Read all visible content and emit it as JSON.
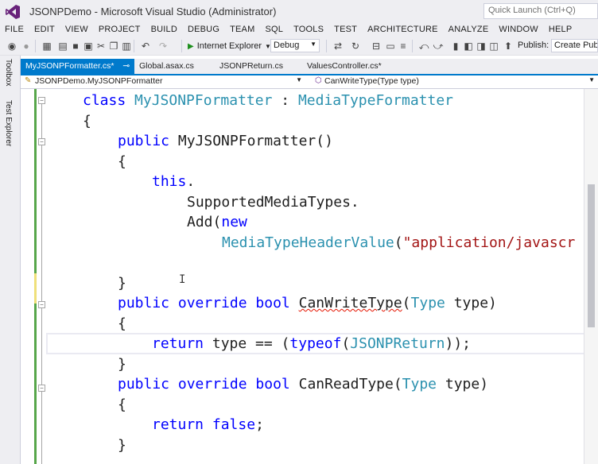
{
  "window": {
    "title": "JSONPDemo - Microsoft Visual Studio (Administrator)",
    "quick_launch_placeholder": "Quick Launch (Ctrl+Q)"
  },
  "menu": [
    "FILE",
    "EDIT",
    "VIEW",
    "PROJECT",
    "BUILD",
    "DEBUG",
    "TEAM",
    "SQL",
    "TOOLS",
    "TEST",
    "ARCHITECTURE",
    "ANALYZE",
    "WINDOW",
    "HELP"
  ],
  "toolbar": {
    "run_target": "Internet Explorer",
    "configuration": "Debug",
    "publish_label": "Publish:",
    "publish_value": "Create Publ"
  },
  "sidebar": {
    "toolbox": "Toolbox",
    "test_explorer": "Test Explorer"
  },
  "tabs": [
    {
      "label": "MyJSONPFormatter.cs*",
      "active": true
    },
    {
      "label": "Global.asax.cs",
      "active": false
    },
    {
      "label": "JSONPReturn.cs",
      "active": false
    },
    {
      "label": "ValuesController.cs*",
      "active": false
    }
  ],
  "navbar": {
    "class_path": "JSONPDemo.MyJSONPFormatter",
    "member": "CanWriteType(Type type)"
  },
  "code": {
    "l1_kw": "class",
    "l1_name": "MyJSONPFormatter",
    "l1_sep": " : ",
    "l1_base": "MediaTypeFormatter",
    "brace_open": "{",
    "brace_close": "}",
    "l3_kw": "public",
    "l3_rest": " MyJSONPFormatter()",
    "l5_kw": "this",
    "l5_dot": ".",
    "l6": "SupportedMediaTypes.",
    "l7_pre": "Add(",
    "l7_kw": "new",
    "l8_type": "MediaTypeHeaderValue",
    "l8_paren": "(",
    "l8_str": "\"application/javascr",
    "l10_kw1": "public",
    "l10_kw2": "override",
    "l10_kw3": "bool",
    "l10_name": "CanWriteType",
    "l10_paren": "(",
    "l10_type": "Type",
    "l10_rest": " type)",
    "l12_kw": "return",
    "l12_mid": " type == (",
    "l12_kw2": "typeof",
    "l12_paren": "(",
    "l12_type": "JSONPReturn",
    "l12_end": "));",
    "l14_kw1": "public",
    "l14_kw2": "override",
    "l14_kw3": "bool",
    "l14_name": " CanReadType(",
    "l14_type": "Type",
    "l14_rest": " type)",
    "l16_kw": "return",
    "l16_kw2": "false",
    "l16_end": ";"
  }
}
